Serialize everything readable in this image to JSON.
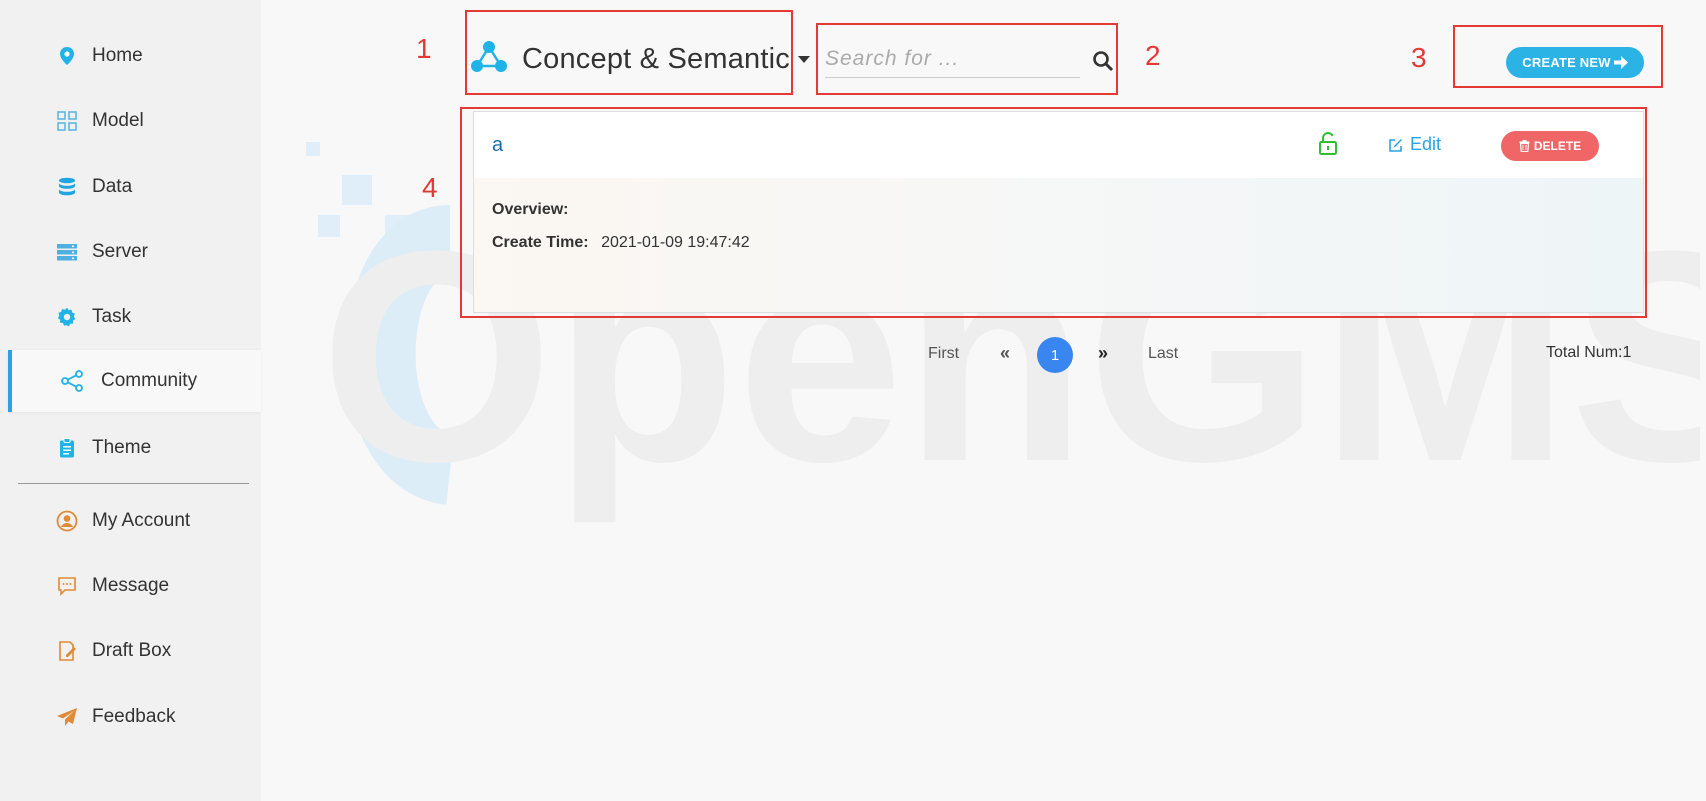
{
  "sidebar": {
    "items": [
      {
        "label": "Home",
        "icon": "location-pin-icon"
      },
      {
        "label": "Model",
        "icon": "grid-icon"
      },
      {
        "label": "Data",
        "icon": "database-icon"
      },
      {
        "label": "Server",
        "icon": "server-icon"
      },
      {
        "label": "Task",
        "icon": "gear-icon"
      },
      {
        "label": "Community",
        "icon": "share-nodes-icon",
        "active": true
      },
      {
        "label": "Theme",
        "icon": "clipboard-icon"
      },
      {
        "label": "My Account",
        "icon": "user-circle-icon"
      },
      {
        "label": "Message",
        "icon": "chat-icon"
      },
      {
        "label": "Draft Box",
        "icon": "draft-icon"
      },
      {
        "label": "Feedback",
        "icon": "paper-plane-icon"
      }
    ]
  },
  "annotations": [
    "1",
    "2",
    "3",
    "4"
  ],
  "header": {
    "category_title": "Concept & Semantic",
    "search_placeholder": "Search for ...",
    "create_label": "CREATE NEW"
  },
  "item": {
    "title": "a",
    "edit_label": "Edit",
    "delete_label": "DELETE",
    "overview_label": "Overview:",
    "overview_value": "",
    "create_time_label": "Create Time:",
    "create_time_value": "2021-01-09 19:47:42"
  },
  "pagination": {
    "first": "First",
    "prev": "«",
    "current": "1",
    "next": "»",
    "last": "Last",
    "total_label": "Total Num:",
    "total_value": "1"
  },
  "watermark": {
    "text": "OpenGMS"
  },
  "colors": {
    "accent": "#2aa3e6",
    "create": "#2bb3e5",
    "delete": "#f06666",
    "page_active": "#3a86f0",
    "annotation": "#e53935"
  }
}
